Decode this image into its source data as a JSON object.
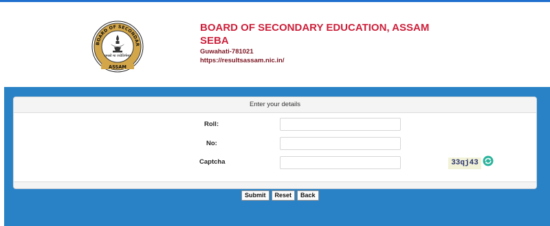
{
  "header": {
    "title": "BOARD OF SECONDARY EDUCATION, ASSAM",
    "subtitle": "SEBA",
    "address": "Guwahati-781021",
    "url": "https://resultsassam.nic.in/",
    "logo": {
      "ring_text": "BOARD OF SECONDARY EDUCATION",
      "motto": "तमसो मा ज्योतिर्गमय",
      "bottom_text": "ASSAM"
    }
  },
  "form": {
    "heading": "Enter your details",
    "roll_label": "Roll:",
    "roll_value": "",
    "no_label": "No:",
    "no_value": "",
    "captcha_label": "Captcha",
    "captcha_value": "",
    "captcha_code": "33qj43",
    "refresh_icon": "refresh-icon"
  },
  "buttons": {
    "submit": "Submit",
    "reset": "Reset",
    "back": "Back"
  },
  "colors": {
    "top_bar": "#1f6fcf",
    "background_band": "#2a82c6",
    "title": "#cc1f3a",
    "refresh_icon": "#2bb39c"
  }
}
